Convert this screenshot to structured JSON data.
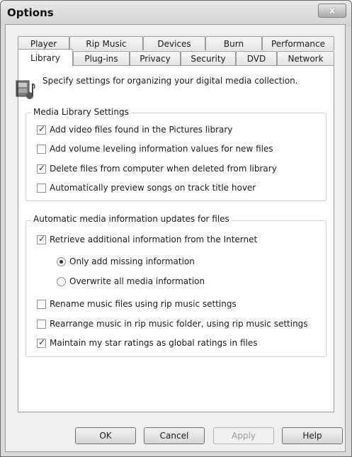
{
  "window": {
    "title": "Options",
    "close_label": "x"
  },
  "tabs_back": [
    "Player",
    "Rip Music",
    "Devices",
    "Burn",
    "Performance"
  ],
  "tabs_front": [
    "Library",
    "Plug-ins",
    "Privacy",
    "Security",
    "DVD",
    "Network"
  ],
  "active_tab": "Library",
  "intro": {
    "icon": "media-library-icon",
    "text": "Specify settings for organizing your digital media collection."
  },
  "media_library_settings": {
    "legend": "Media Library Settings",
    "items": [
      {
        "label": "Add video files found in the Pictures library",
        "checked": true
      },
      {
        "label": "Add volume leveling information values for new files",
        "checked": false
      },
      {
        "label": "Delete files from computer when deleted from library",
        "checked": true
      },
      {
        "label": "Automatically preview songs on track title hover",
        "checked": false
      }
    ]
  },
  "auto_updates": {
    "legend": "Automatic media information updates for files",
    "retrieve": {
      "label": "Retrieve additional information from the Internet",
      "checked": true
    },
    "radios": [
      {
        "label": "Only add missing information",
        "checked": true
      },
      {
        "label": "Overwrite all media information",
        "checked": false
      }
    ],
    "items": [
      {
        "label": "Rename music files using rip music settings",
        "checked": false
      },
      {
        "label": "Rearrange music in rip music folder, using rip music settings",
        "checked": false
      },
      {
        "label": "Maintain my star ratings as global ratings in files",
        "checked": true
      }
    ]
  },
  "buttons": {
    "ok": "OK",
    "cancel": "Cancel",
    "apply": "Apply",
    "help": "Help"
  }
}
